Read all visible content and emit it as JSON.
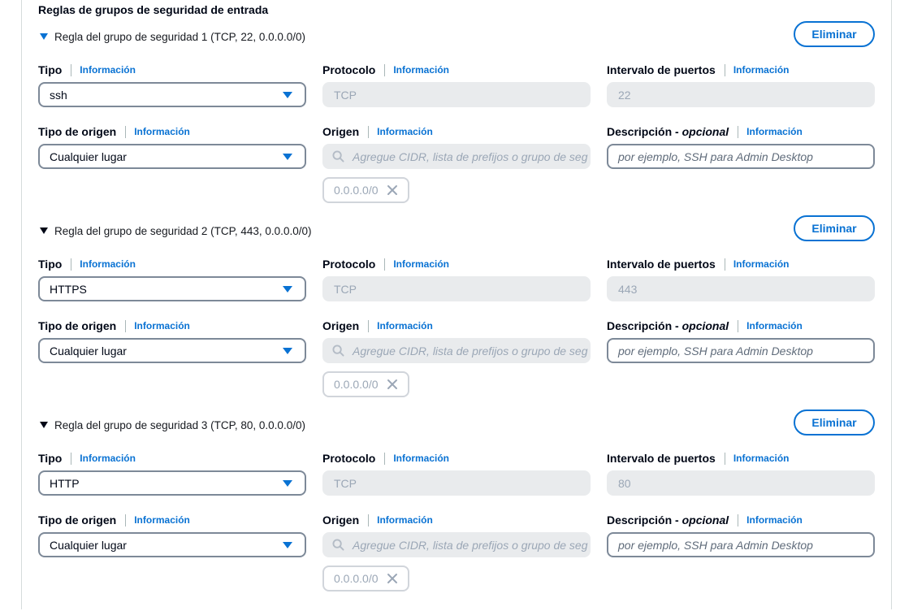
{
  "section": {
    "title": "Reglas de grupos de seguridad de entrada"
  },
  "labels": {
    "type": "Tipo",
    "protocol": "Protocolo",
    "port_range": "Intervalo de puertos",
    "source_type": "Tipo de origen",
    "source": "Origen",
    "description": "Descripción - ",
    "optional": "opcional",
    "info": "Información",
    "delete": "Eliminar",
    "source_placeholder": "Agregue CIDR, lista de prefijos o grupo de seg",
    "description_placeholder": "por ejemplo, SSH para Admin Desktop"
  },
  "rules": [
    {
      "header": "Regla del grupo de seguridad 1 (TCP, 22, 0.0.0.0/0)",
      "type": "ssh",
      "protocol": "TCP",
      "port": "22",
      "source_type": "Cualquier lugar",
      "cidr": "0.0.0.0/0",
      "caret_color": "#0972d3"
    },
    {
      "header": "Regla del grupo de seguridad 2 (TCP, 443, 0.0.0.0/0)",
      "type": "HTTPS",
      "protocol": "TCP",
      "port": "443",
      "source_type": "Cualquier lugar",
      "cidr": "0.0.0.0/0",
      "caret_color": "#000716"
    },
    {
      "header": "Regla del grupo de seguridad 3 (TCP, 80, 0.0.0.0/0)",
      "type": "HTTP",
      "protocol": "TCP",
      "port": "80",
      "source_type": "Cualquier lugar",
      "cidr": "0.0.0.0/0",
      "caret_color": "#000716"
    }
  ],
  "icons": {
    "expand": "caret-down-icon",
    "dropdown": "chevron-down-icon",
    "search": "search-icon",
    "remove": "close-icon"
  }
}
